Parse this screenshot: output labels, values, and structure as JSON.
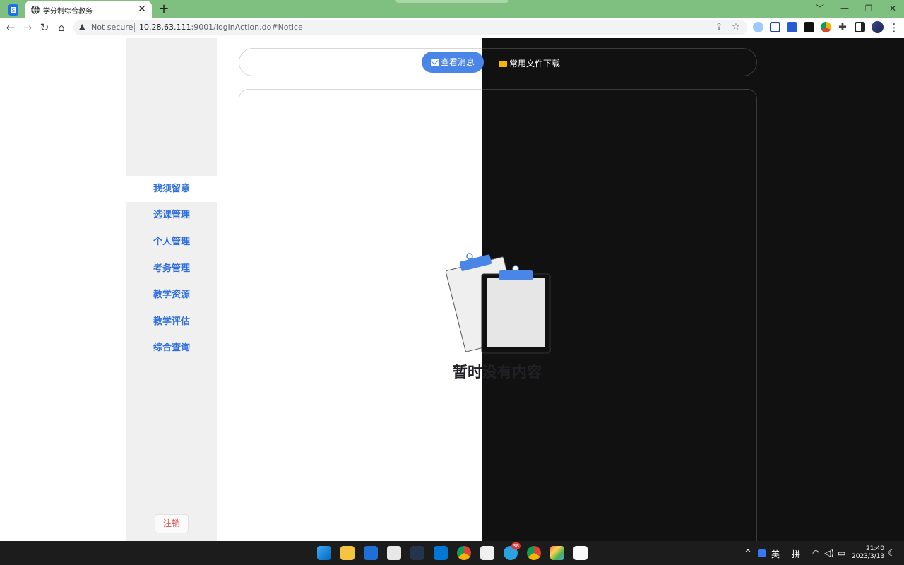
{
  "browser": {
    "tab_title": "学分制综合教务",
    "tab_close": "✕",
    "new_tab": "+",
    "security_label": "Not secure",
    "url_host": "10.28.63.111",
    "url_path": ":9001/loginAction.do#Notice",
    "window_controls": [
      "﹀",
      "—",
      "❐",
      "✕"
    ]
  },
  "sidebar": {
    "items": [
      {
        "label": "我须留意",
        "active": true
      },
      {
        "label": "选课管理",
        "active": false
      },
      {
        "label": "个人管理",
        "active": false
      },
      {
        "label": "考务管理",
        "active": false
      },
      {
        "label": "教学资源",
        "active": false
      },
      {
        "label": "教学评估",
        "active": false
      },
      {
        "label": "综合查询",
        "active": false
      }
    ],
    "logout_label": "注销"
  },
  "topbar": {
    "messages_label": "查看消息",
    "files_label": "常用文件下载"
  },
  "content": {
    "empty_text": "暂时没有内容"
  },
  "taskbar": {
    "tray_lang": "英",
    "tray_ime": "拼",
    "tray_up": "^",
    "time": "21:40",
    "date": "2023/3/13",
    "badge": "38"
  },
  "colors": {
    "accent": "#4a86e8",
    "nav_text": "#2f6fe0",
    "logout_text": "#d9534f",
    "title_bar": "#7fbf7f"
  }
}
